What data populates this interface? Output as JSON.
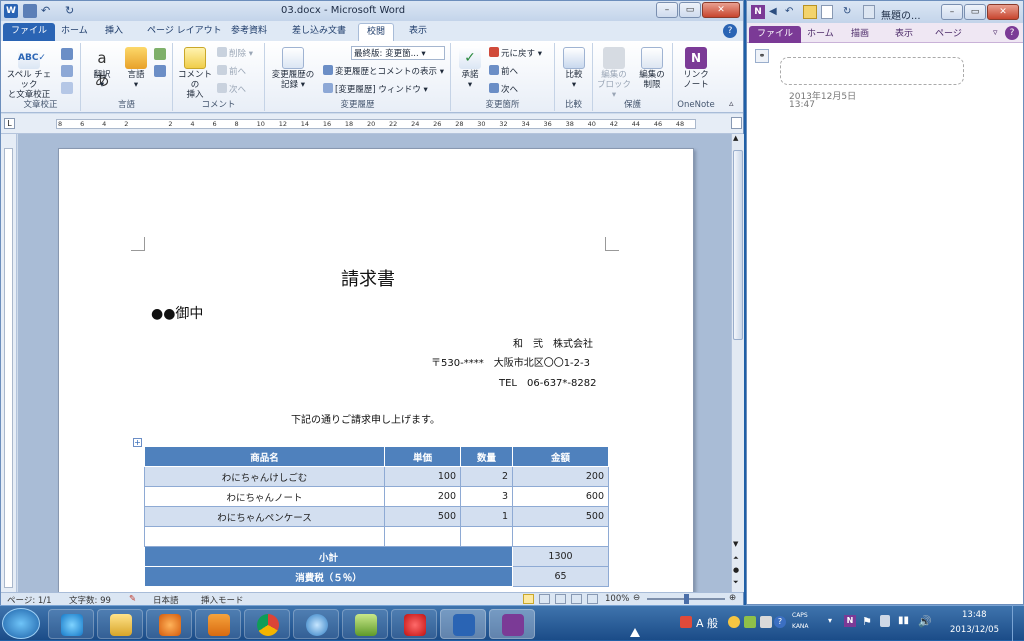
{
  "word": {
    "title": "03.docx - Microsoft Word",
    "tabs": [
      "ファイル",
      "ホーム",
      "挿入",
      "ページ レイアウト",
      "参考資料",
      "差し込み文書",
      "校閲",
      "表示"
    ],
    "active_tab": "校閲",
    "ribbon": {
      "proof": {
        "spell": "スペル チェック",
        "spell2": "と文章校正",
        "group": "文章校正"
      },
      "lang": {
        "translate": "翻訳",
        "language": "言語",
        "group": "言語"
      },
      "comment": {
        "new": "コメントの",
        "new2": "挿入",
        "delete": "削除",
        "prev": "前へ",
        "next": "次へ",
        "group": "コメント"
      },
      "tracking": {
        "track": "変更履歴の",
        "track2": "記録",
        "final": "最終版: 変更箇...",
        "show": "変更履歴とコメントの表示",
        "pane": "[変更履歴] ウィンドウ",
        "group": "変更履歴"
      },
      "changes": {
        "accept": "承諾",
        "reject": "元に戻す",
        "prev": "前へ",
        "next": "次へ",
        "group": "変更箇所"
      },
      "compare": {
        "compare": "比較",
        "group": "比較"
      },
      "protect": {
        "block": "編集の",
        "block2": "ブロック",
        "restrict": "編集の",
        "restrict2": "制限",
        "group": "保護"
      },
      "onenote": {
        "link": "リンク",
        "link2": "ノート",
        "group": "OneNote"
      }
    },
    "ruler_ticks": [
      "8",
      "6",
      "4",
      "2",
      "",
      "2",
      "4",
      "6",
      "8",
      "10",
      "12",
      "14",
      "16",
      "18",
      "20",
      "22",
      "24",
      "26",
      "28",
      "30",
      "32",
      "34",
      "36",
      "38",
      "40",
      "42",
      "44",
      "46",
      "48"
    ],
    "document": {
      "title": "請求書",
      "recipient": "●●御中",
      "company": "和　弐　株式会社",
      "address": "〒530-****　大阪市北区〇〇1-2-3",
      "tel": "TEL　06-637*-8282",
      "intro": "下記の通りご請求申し上げます。",
      "table": {
        "headers": [
          "商品名",
          "単価",
          "数量",
          "金額"
        ],
        "rows": [
          [
            "わにちゃんけしごむ",
            "100",
            "2",
            "200"
          ],
          [
            "わにちゃんノート",
            "200",
            "3",
            "600"
          ],
          [
            "わにちゃんペンケース",
            "500",
            "1",
            "500"
          ]
        ],
        "subtotal_label": "小計",
        "subtotal": "1300",
        "tax_label": "消費税（５％）",
        "tax": "65"
      }
    },
    "status": {
      "page": "ページ: 1/1",
      "words": "文字数: 99",
      "lang": "日本語",
      "mode": "挿入モード",
      "zoom": "100%"
    }
  },
  "onenote": {
    "title": "無題の...",
    "tabs": [
      "ファイル",
      "ホーム",
      "描画",
      "表示",
      "ページ"
    ],
    "date": "2013年12月5日",
    "time": "13:47"
  },
  "taskbar": {
    "ime": "A 般",
    "caps": "CAPS",
    "kana": "KANA",
    "time": "13:48",
    "date": "2013/12/05"
  }
}
